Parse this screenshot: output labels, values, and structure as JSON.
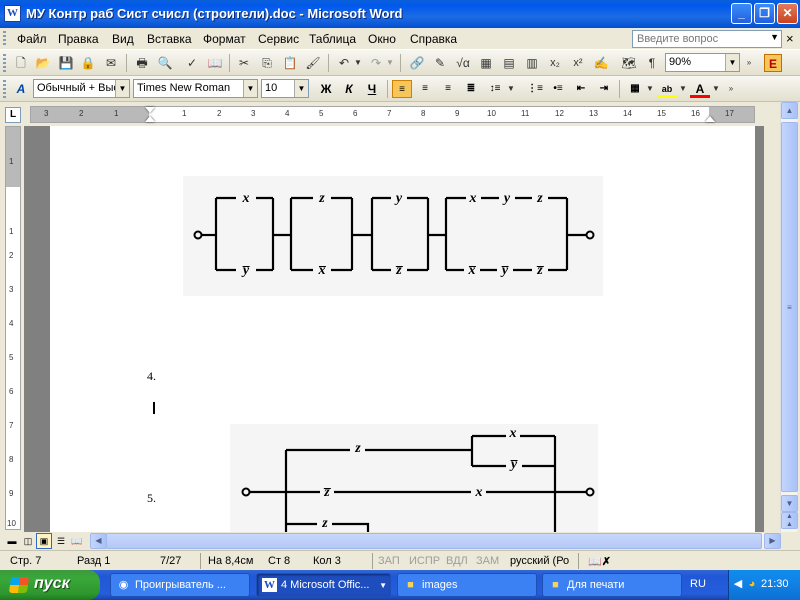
{
  "window": {
    "app_icon": "W",
    "title": "МУ Контр раб Сист счисл (строители).doc - Microsoft Word",
    "controls": [
      "_",
      "❐",
      "✕"
    ]
  },
  "menubar": {
    "items": [
      "Файл",
      "Правка",
      "Вид",
      "Вставка",
      "Формат",
      "Сервис",
      "Таблица",
      "Окно",
      "Справка"
    ],
    "help_placeholder": "Введите вопрос",
    "close_doc": "×"
  },
  "standard_toolbar": {
    "zoom": "90%"
  },
  "format_toolbar": {
    "style": "Обычный + Выс",
    "font": "Times New Roman",
    "size": "10",
    "bold": "Ж",
    "italic": "К",
    "underline": "Ч"
  },
  "ruler": {
    "numbers": [
      "3",
      "2",
      "1",
      "1",
      "2",
      "3",
      "4",
      "5",
      "6",
      "7",
      "8",
      "9",
      "10",
      "11",
      "12",
      "13",
      "14",
      "15",
      "16",
      "17"
    ],
    "vertical_numbers": [
      "1",
      "1",
      "2",
      "3",
      "4",
      "5",
      "6",
      "7",
      "8",
      "9",
      "10"
    ],
    "corner": "L"
  },
  "document": {
    "items": [
      {
        "label": "4."
      },
      {
        "label": "5."
      }
    ],
    "circuit1": {
      "labels": {
        "b1_top": "x",
        "b1_bot": "y̅",
        "b2_top": "z",
        "b2_bot": "x̅",
        "b3_top": "y",
        "b3_bot": "z̅",
        "b4_top": [
          "x",
          "y",
          "z"
        ],
        "b4_bot": [
          "x̅",
          "y̅",
          "z̅"
        ]
      }
    },
    "circuit2": {
      "labels": {
        "top_z": "z",
        "top_x": "x",
        "top_y": "y̅",
        "mid_z": "z̅",
        "mid_x": "x",
        "bot_z": "z"
      }
    }
  },
  "statusbar": {
    "page": "Стр. 7",
    "section": "Разд 1",
    "pages": "7/27",
    "at": "На 8,4см",
    "line": "Ст 8",
    "col": "Кол 3",
    "rec": "ЗАП",
    "trk": "ИСПР",
    "ext": "ВДЛ",
    "ovr": "ЗАМ",
    "language": "русский (Ро"
  },
  "taskbar": {
    "start": "пуск",
    "tasks": [
      {
        "label": "Проигрыватель ...",
        "icon": "media-player-icon"
      },
      {
        "label": "4 Microsoft Offic...",
        "icon": "word-icon"
      },
      {
        "label": "images",
        "icon": "folder-icon"
      },
      {
        "label": "Для печати",
        "icon": "folder-icon"
      }
    ],
    "lang": "RU",
    "clock": "21:30"
  },
  "colors": {
    "titlebar": "#0058EE",
    "taskbar": "#245EDC",
    "start": "#38A838",
    "doc_bg": "#808080"
  }
}
